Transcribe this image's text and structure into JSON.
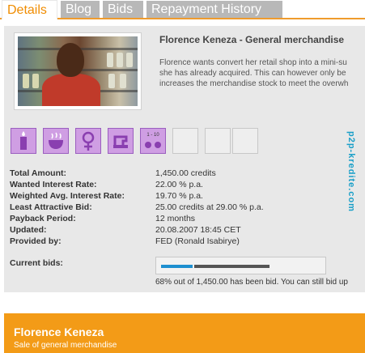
{
  "tabs": [
    {
      "label": "Details",
      "active": true
    },
    {
      "label": "Blog",
      "active": false
    },
    {
      "label": "Bids",
      "active": false
    },
    {
      "label": "Repayment History",
      "active": false
    }
  ],
  "loan": {
    "title": "Florence Keneza - General merchandise",
    "description_lines": [
      "Florence wants convert her retail shop into a mini-su",
      "she has already acquired. This can however only be",
      "increases the merchandise stock to meet the overwh"
    ]
  },
  "watermark": "p2p-kredite.com",
  "category_icons": [
    {
      "name": "candle-icon",
      "filled": true
    },
    {
      "name": "cooking-pot-icon",
      "filled": true
    },
    {
      "name": "female-symbol-icon",
      "filled": true
    },
    {
      "name": "sewing-machine-icon",
      "filled": true
    },
    {
      "name": "rating-icon",
      "filled": true,
      "text": "1 - 10"
    },
    {
      "name": "empty-slot-icon",
      "filled": false
    },
    {
      "name": "empty-slot-icon",
      "filled": false
    },
    {
      "name": "empty-slot-icon",
      "filled": false
    }
  ],
  "details": [
    {
      "label": "Total Amount:",
      "value": "1,450.00 credits"
    },
    {
      "label": "Wanted Interest Rate:",
      "value": "22.00 % p.a."
    },
    {
      "label": "Weighted Avg. Interest Rate:",
      "value": "19.70 % p.a."
    },
    {
      "label": "Least Attractive Bid:",
      "value": "25.00 credits at 29.00 % p.a."
    },
    {
      "label": "Payback Period:",
      "value": "12 months"
    },
    {
      "label": "Updated:",
      "value": "20.08.2007 18:45 CET"
    },
    {
      "label": "Provided by:",
      "value": "FED (Ronald Isabirye)"
    }
  ],
  "bids": {
    "label": "Current bids:",
    "funded_percent": 68,
    "status_text": "68% out of 1,450.00 has been bid. You can still bid up",
    "colors": {
      "funded": "#1e8fd0",
      "remaining": "#555555"
    }
  },
  "banner": {
    "name": "Florence Keneza",
    "subtitle": "Sale of general merchandise",
    "color": "#f39b17"
  },
  "colors": {
    "accent": "#f08c00",
    "panel": "#e8e8e8",
    "tab_inactive": "#b8b8b8",
    "icon_purple": "#cf9ee3"
  }
}
